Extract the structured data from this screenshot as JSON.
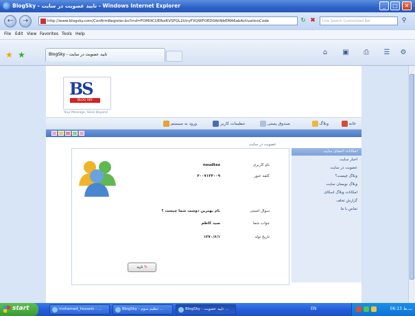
{
  "window": {
    "title": "BlogSky - تایید عضویت در سایت - Windows Internet Explorer",
    "minimize": "_",
    "maximize": "□",
    "close": "✕"
  },
  "address": {
    "url": "http://www.blogsky.com/ConfirmRegister.bs?rnd=FOMIXCUERolKVSFQL2UiryFXQWFOED0AtlNbEMA6abActivationCode",
    "search_placeholder": "Live Search Customized Bar"
  },
  "menu": [
    "File",
    "Edit",
    "View",
    "Favorites",
    "Tools",
    "Help"
  ],
  "tab": {
    "label": "BlogSky - تایید عضویت در سایت"
  },
  "site": {
    "logo_text": "BS",
    "logo_band": "BLOG SKY",
    "tagline": "Your Message, Skies Beyond",
    "nav": [
      {
        "label": "خانه"
      },
      {
        "label": "وبلاگ"
      },
      {
        "label": "صندوق پستی"
      },
      {
        "label": "تنظیمات کاربر"
      },
      {
        "label": "ورود به سیستم"
      }
    ],
    "breadcrumb": "عضویت در سایت"
  },
  "form": {
    "username_label": "نام کاربری",
    "username_value": "noudtez",
    "password_label": "کلمه عبور",
    "password_value": "۴۰۰۷۱۳۴۰۰۹",
    "question_label": "سوال امنیتی",
    "question_value": "نام بهترین دوست شما چیست ؟",
    "answer_label": "جواب شما",
    "answer_value": "سید کاظم",
    "birth_label": "تاریخ تولد",
    "birth_value": "۱۳۷۰/۶/۱",
    "confirm_label": "تایید"
  },
  "sidebar": {
    "title": "امکانات اعضای سایت",
    "items": [
      "اخبار سایت",
      "عضویت در سایت",
      "وبلاگ چیست؟",
      "وبلاگ نویسان سایت",
      "امکانات وبلاگ اسکای",
      "گزارش تخلف",
      "تماس با ما"
    ]
  },
  "taskbar": {
    "start": "start",
    "tasks": [
      "mohamad_hossein - ...",
      "BlogSky - تنظیم سوم ...",
      "BlogSky - تایید عضویت ..."
    ],
    "lang": "EN",
    "clock": "06:13 ب.ظ"
  },
  "colors": {
    "titlebar": "#2f62c8",
    "nav_strip": "#4a77c4",
    "sidebar_bg": "#e2ebf7"
  }
}
